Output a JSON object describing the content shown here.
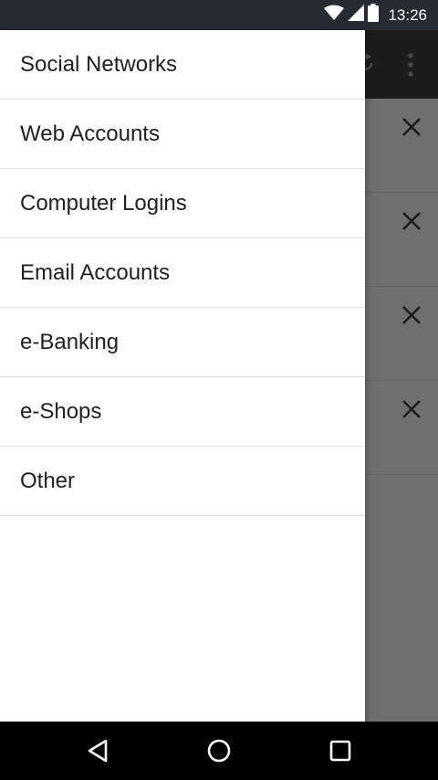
{
  "status_bar": {
    "time": "13:26",
    "icons": [
      "wifi-icon",
      "cell-signal-icon",
      "battery-icon"
    ]
  },
  "drawer": {
    "items": [
      {
        "label": "Social Networks"
      },
      {
        "label": "Web Accounts"
      },
      {
        "label": "Computer Logins"
      },
      {
        "label": "Email Accounts"
      },
      {
        "label": "e-Banking"
      },
      {
        "label": "e-Shops"
      },
      {
        "label": "Other"
      }
    ]
  },
  "app_behind": {
    "toolbar_icons": [
      "refresh-icon",
      "overflow-menu-icon"
    ],
    "row_count": 4,
    "row_icon": "close-icon"
  },
  "nav_bar": {
    "icons": [
      "back-icon",
      "home-icon",
      "recents-icon"
    ]
  },
  "colors": {
    "status_bar": "#262a33",
    "toolbar": "#3b3b3b",
    "drawer_bg": "#ffffff",
    "text": "#212121",
    "nav_bar": "#000000"
  }
}
